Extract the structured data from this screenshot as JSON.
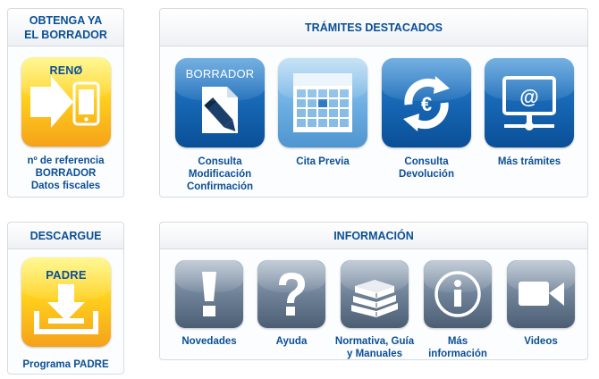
{
  "borrador_panel": {
    "title_line1": "OBTENGA YA",
    "title_line2": "EL BORRADOR",
    "tile_label": "RENØ",
    "caption_lines": [
      "nº de referencia",
      "BORRADOR",
      "Datos fiscales"
    ]
  },
  "tramites_panel": {
    "title": "TRÁMITES DESTACADOS",
    "items": [
      {
        "tile_text": "BORRADOR",
        "icon": "document-pen-icon",
        "caption_lines": [
          "Consulta",
          "Modificación",
          "Confirmación"
        ]
      },
      {
        "icon": "calendar-icon",
        "caption_lines": [
          "Cita Previa"
        ]
      },
      {
        "icon": "euro-refresh-icon",
        "caption_lines": [
          "Consulta",
          "Devolución"
        ]
      },
      {
        "icon": "monitor-at-icon",
        "caption_lines": [
          "Más trámites"
        ]
      }
    ]
  },
  "descargue_panel": {
    "title": "DESCARGUE",
    "tile_label": "PADRE",
    "caption": "Programa PADRE"
  },
  "informacion_panel": {
    "title": "INFORMACIÓN",
    "items": [
      {
        "icon": "exclamation-icon",
        "caption_lines": [
          "Novedades"
        ]
      },
      {
        "icon": "question-icon",
        "caption_lines": [
          "Ayuda"
        ]
      },
      {
        "icon": "books-icon",
        "caption_lines": [
          "Normativa, Guía",
          "y Manuales"
        ]
      },
      {
        "icon": "info-icon",
        "caption_lines": [
          "Más",
          "información"
        ]
      },
      {
        "icon": "video-camera-icon",
        "caption_lines": [
          "Videos"
        ]
      }
    ]
  },
  "colors": {
    "title_blue": "#0b4f96",
    "tile_blue": "#1767b5",
    "tile_light_blue": "#6fb0e3",
    "tile_slate": "#6f8298",
    "tile_yellow": "#ffd01c"
  }
}
